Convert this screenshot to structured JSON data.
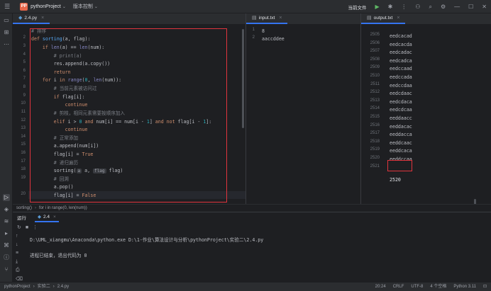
{
  "titlebar": {
    "project_badge": "PP",
    "project_name": "pythonProject",
    "vcs": "版本控制",
    "run_config": "当前文件"
  },
  "main_editor": {
    "tab_label": "2.4.py",
    "line_numbers": [
      "",
      "2",
      "3",
      "4",
      "5",
      "6",
      "7",
      "8",
      "9",
      "10",
      "11",
      "12",
      "13",
      "14",
      "15",
      "16",
      "17",
      "18",
      "19",
      "20"
    ],
    "lines": [
      "# 排序",
      "def sorting(a, flag):",
      "    if len(a) == len(num):",
      "        # print(a)",
      "        res.append(a.copy())",
      "        return",
      "    for i in range(0, len(num)):",
      "        # 当前元素被访问过",
      "        if flag[i]:",
      "            continue",
      "        # 剪枝，相同元素需要按顺序加入",
      "        elif i > 0 and num[i] == num[i - 1] and not flag[i - 1]:",
      "            continue",
      "        # 正常添加",
      "        a.append(num[i])",
      "        flag[i] = True",
      "        # 递归遍历",
      "        sorting(a a, flag flag)",
      "        # 回溯",
      "        a.pop()",
      "        flag[i] = False"
    ]
  },
  "input_editor": {
    "tab_label": "input.txt",
    "line_numbers": [
      "1",
      "2"
    ],
    "lines": [
      "8",
      "aaccddee"
    ]
  },
  "output_editor": {
    "tab_label": "output.txt",
    "line_numbers": [
      "2505",
      "2506",
      "2507",
      "2508",
      "2509",
      "2510",
      "2511",
      "2512",
      "2513",
      "2514",
      "2515",
      "2516",
      "2517",
      "2518",
      "2519",
      "2520",
      "2521"
    ],
    "lines": [
      "eedcacad",
      "eedcacda",
      "eedcadac",
      "eedcadca",
      "eedccaad",
      "eedccada",
      "eedccdaa",
      "eedcdaac",
      "eedcdaca",
      "eedcdcaa",
      "eeddaacc",
      "eeddacac",
      "eeddacca",
      "eeddcaac",
      "eeddcaca",
      "eeddccaa",
      "2520"
    ]
  },
  "breadcrumbs": [
    "sorting()",
    "for i in range(0, len(num))"
  ],
  "run_panel": {
    "title": "运行",
    "tab_label": "2.4",
    "console": [
      "D:\\UML_xiangmu\\Anaconda\\python.exe D:\\1-作业\\算法设计与分析\\pythonProject\\实验二\\2.4.py",
      "",
      "进程已结束，退出代码为 0"
    ]
  },
  "statusbar": {
    "path": [
      "pythonProject",
      "实验二",
      "2.4.py"
    ],
    "position": "20:24",
    "line_sep": "CRLF",
    "encoding": "UTF-8",
    "indent": "4 个空格",
    "interpreter": "Python 3.11"
  },
  "colors": {
    "highlight_box": "#e0343d",
    "accent": "#3574f0",
    "background": "#1e1f22"
  }
}
